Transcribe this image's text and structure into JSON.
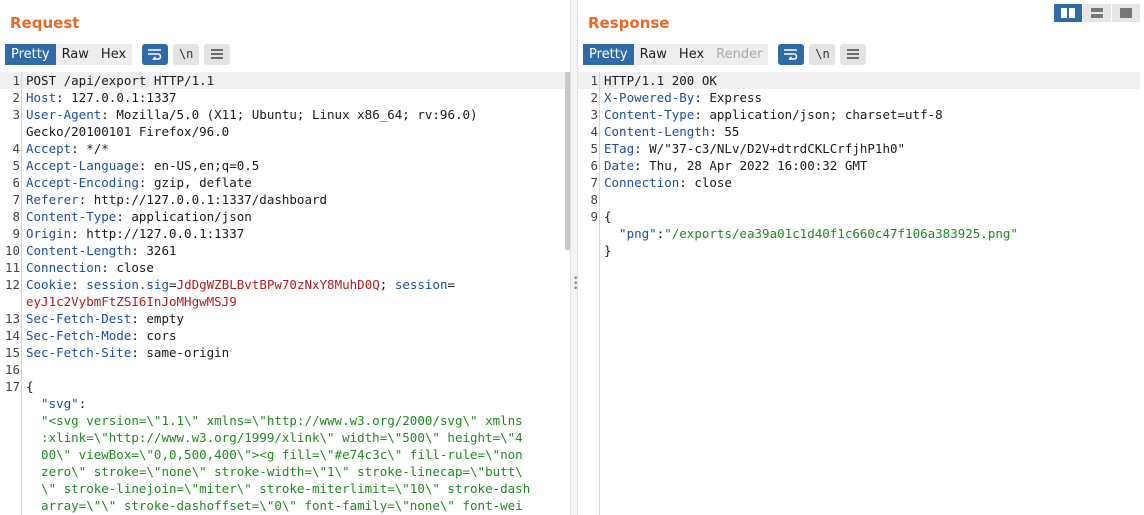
{
  "request": {
    "title": "Request",
    "tabs": [
      "Pretty",
      "Raw",
      "Hex"
    ],
    "active_tab": "Pretty",
    "tools": {
      "wrap_icon": "wrap-lines-icon",
      "newline_label": "\\n",
      "menu_icon": "hamburger-menu-icon"
    },
    "lines": [
      {
        "n": "1",
        "text": "POST /api/export HTTP/1.1"
      },
      {
        "n": "2",
        "key": "Host",
        "val": ": 127.0.0.1:1337"
      },
      {
        "n": "3",
        "key": "User-Agent",
        "val": ": Mozilla/5.0 (X11; Ubuntu; Linux x86_64; rv:96.0)"
      },
      {
        "n": "",
        "text": "Gecko/20100101 Firefox/96.0"
      },
      {
        "n": "4",
        "key": "Accept",
        "val": ": */*"
      },
      {
        "n": "5",
        "key": "Accept-Language",
        "val": ": en-US,en;q=0.5"
      },
      {
        "n": "6",
        "key": "Accept-Encoding",
        "val": ": gzip, deflate"
      },
      {
        "n": "7",
        "key": "Referer",
        "val": ": http://127.0.0.1:1337/dashboard"
      },
      {
        "n": "8",
        "key": "Content-Type",
        "val": ": application/json"
      },
      {
        "n": "9",
        "key": "Origin",
        "val": ": http://127.0.0.1:1337"
      },
      {
        "n": "10",
        "key": "Content-Length",
        "val": ": 3261"
      },
      {
        "n": "11",
        "key": "Connection",
        "val": ": close"
      },
      {
        "n": "12",
        "cookie": true
      },
      {
        "n": "",
        "text_red": "eyJ1c2VybmFtZSI6InJoMHgwMSJ9"
      },
      {
        "n": "13",
        "key": "Sec-Fetch-Dest",
        "val": ": empty"
      },
      {
        "n": "14",
        "key": "Sec-Fetch-Mode",
        "val": ": cors"
      },
      {
        "n": "15",
        "key": "Sec-Fetch-Site",
        "val": ": same-origin"
      },
      {
        "n": "16",
        "text": ""
      },
      {
        "n": "17",
        "text": "{"
      },
      {
        "n": "",
        "json_key": "  \"svg\"",
        "after": ":"
      },
      {
        "n": "",
        "green": "  \"<svg version=\\\"1.1\\\" xmlns=\\\"http://www.w3.org/2000/svg\\\" xmlns"
      },
      {
        "n": "",
        "green": "  :xlink=\\\"http://www.w3.org/1999/xlink\\\" width=\\\"500\\\" height=\\\"4"
      },
      {
        "n": "",
        "green": "  00\\\" viewBox=\\\"0,0,500,400\\\"><g fill=\\\"#e74c3c\\\" fill-rule=\\\"non"
      },
      {
        "n": "",
        "green": "  zero\\\" stroke=\\\"none\\\" stroke-width=\\\"1\\\" stroke-linecap=\\\"butt\\"
      },
      {
        "n": "",
        "green": "  \\\" stroke-linejoin=\\\"miter\\\" stroke-miterlimit=\\\"10\\\" stroke-dash"
      },
      {
        "n": "",
        "green": "  array=\\\"\\\" stroke-dashoffset=\\\"0\\\" font-family=\\\"none\\\" font-wei"
      }
    ],
    "cookie": {
      "key": "Cookie",
      "sep": ": ",
      "name1": "session.sig",
      "eq": "=",
      "val1": "JdDgWZBLBvtBPw70zNxY8MuhD0Q",
      "semi": "; ",
      "name2": "session",
      "eq2": "="
    }
  },
  "response": {
    "title": "Response",
    "tabs": [
      "Pretty",
      "Raw",
      "Hex",
      "Render"
    ],
    "active_tab": "Pretty",
    "disabled_tab": "Render",
    "lines": [
      {
        "n": "1",
        "text": "HTTP/1.1 200 OK"
      },
      {
        "n": "2",
        "key": "X-Powered-By",
        "val": ": Express"
      },
      {
        "n": "3",
        "key": "Content-Type",
        "val": ": application/json; charset=utf-8"
      },
      {
        "n": "4",
        "key": "Content-Length",
        "val": ": 55"
      },
      {
        "n": "5",
        "key": "ETag",
        "val": ": W/\"37-c3/NLv/D2V+dtrdCKLCrfjhP1h0\""
      },
      {
        "n": "6",
        "key": "Date",
        "val": ": Thu, 28 Apr 2022 16:00:32 GMT"
      },
      {
        "n": "7",
        "key": "Connection",
        "val": ": close"
      },
      {
        "n": "8",
        "text": ""
      },
      {
        "n": "9",
        "text": "{"
      },
      {
        "n": "",
        "json_key": "  \"png\"",
        "after": ":",
        "green": "\"/exports/ea39a01c1d40f1c660c47f106a383925.png\""
      },
      {
        "n": "",
        "text": "}"
      }
    ]
  },
  "layout_buttons": [
    "split-horizontal-icon",
    "split-vertical-icon",
    "single-pane-icon"
  ],
  "colors": {
    "title": "#e8692b",
    "accent": "#2f6ba8",
    "header_key": "#1b4fa0",
    "cookie_value": "#b31c1c",
    "json_string": "#1f8a1f"
  }
}
